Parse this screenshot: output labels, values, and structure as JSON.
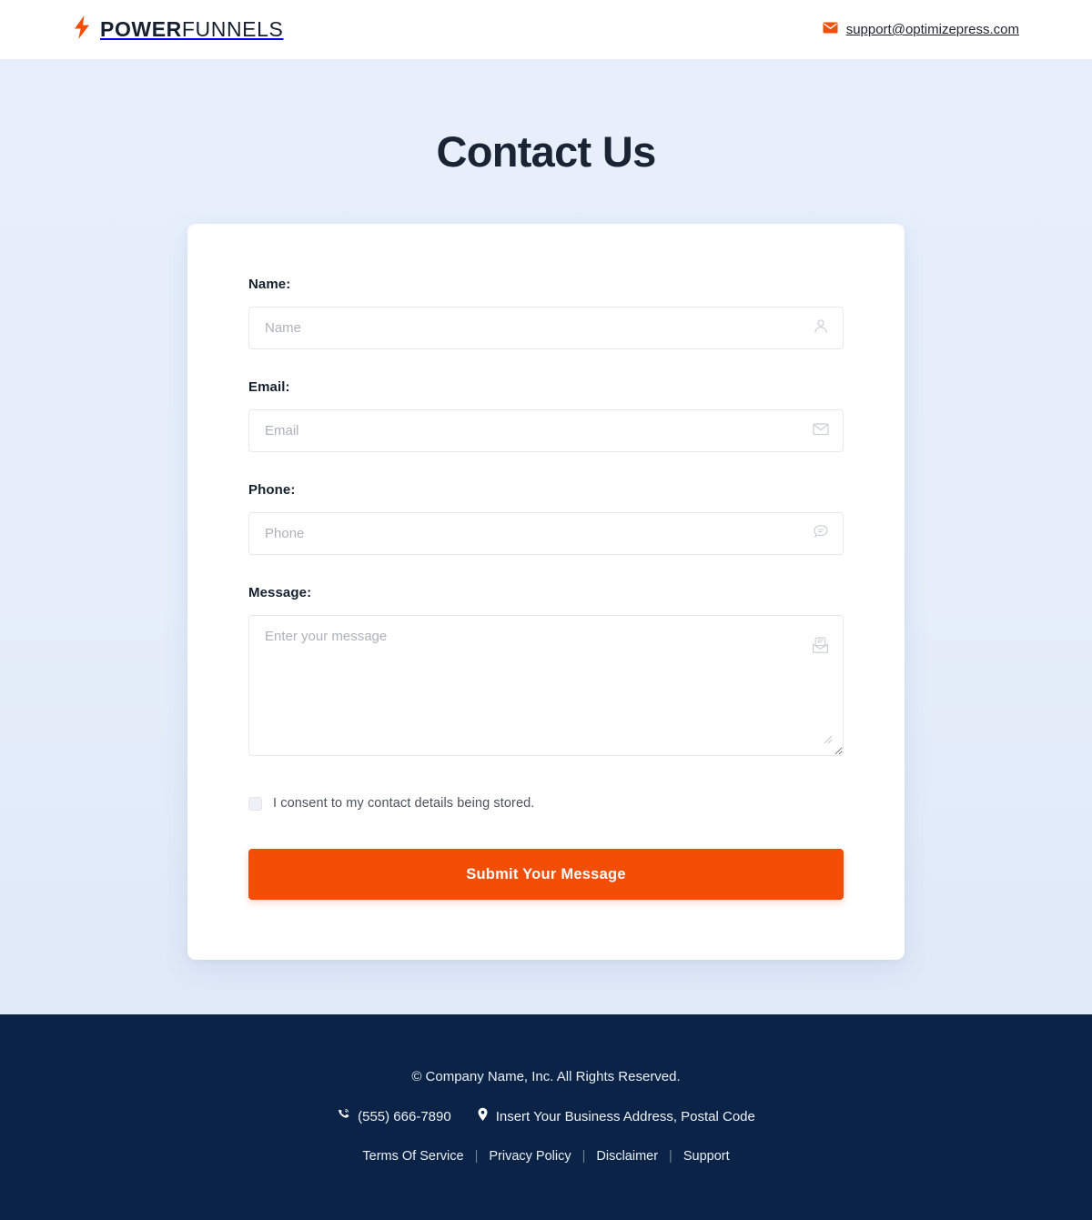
{
  "header": {
    "brand_bold": "POWER",
    "brand_light": "FUNNELS",
    "bolt_icon": "lightning-bolt-icon",
    "mail_icon": "envelope-icon",
    "email": "support@optimizepress.com",
    "accent_color": "#f24e06"
  },
  "main": {
    "title": "Contact Us",
    "fields": {
      "name": {
        "label": "Name:",
        "placeholder": "Name",
        "value": "",
        "icon": "user-icon"
      },
      "email": {
        "label": "Email:",
        "placeholder": "Email",
        "value": "",
        "icon": "envelope-icon"
      },
      "phone": {
        "label": "Phone:",
        "placeholder": "Phone",
        "value": "",
        "icon": "chat-bubble-icon"
      },
      "message": {
        "label": "Message:",
        "placeholder": "Enter your message",
        "value": "",
        "icon": "open-envelope-icon"
      }
    },
    "consent_label": "I consent to my contact details being stored.",
    "consent_checked": false,
    "submit_label": "Submit Your Message"
  },
  "footer": {
    "copyright": "© Company Name, Inc. All Rights Reserved.",
    "phone_icon": "phone-icon",
    "phone": "(555) 666-7890",
    "location_icon": "map-pin-icon",
    "address": "Insert Your Business Address, Postal Code",
    "links": [
      {
        "label": "Terms Of Service"
      },
      {
        "label": "Privacy Policy"
      },
      {
        "label": "Disclaimer"
      },
      {
        "label": "Support"
      }
    ],
    "background_color": "#0a2346"
  }
}
